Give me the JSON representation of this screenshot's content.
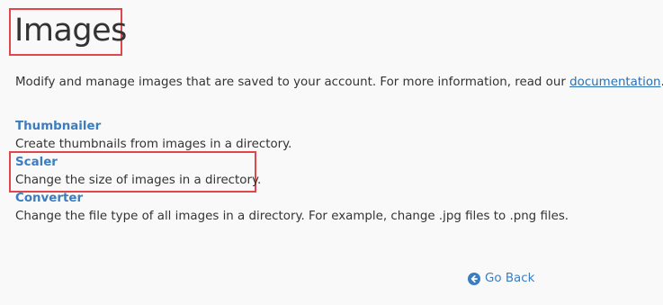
{
  "page": {
    "title": "Images",
    "intro_text": "Modify and manage images that are saved to your account. For more information, read our ",
    "intro_link": "documentation",
    "intro_end": "."
  },
  "tools": [
    {
      "name": "Thumbnailer",
      "description": "Create thumbnails from images in a directory."
    },
    {
      "name": "Scaler",
      "description": "Change the size of images in a directory."
    },
    {
      "name": "Converter",
      "description": "Change the file type of all images in a directory. For example, change .jpg files to .png files."
    }
  ],
  "footer": {
    "go_back_label": "Go Back",
    "go_back_icon": "arrow-circle-left-icon"
  },
  "colors": {
    "link": "#3a7dc0",
    "highlight": "#e0474c",
    "text": "#333333",
    "background": "#f9f9f9"
  }
}
